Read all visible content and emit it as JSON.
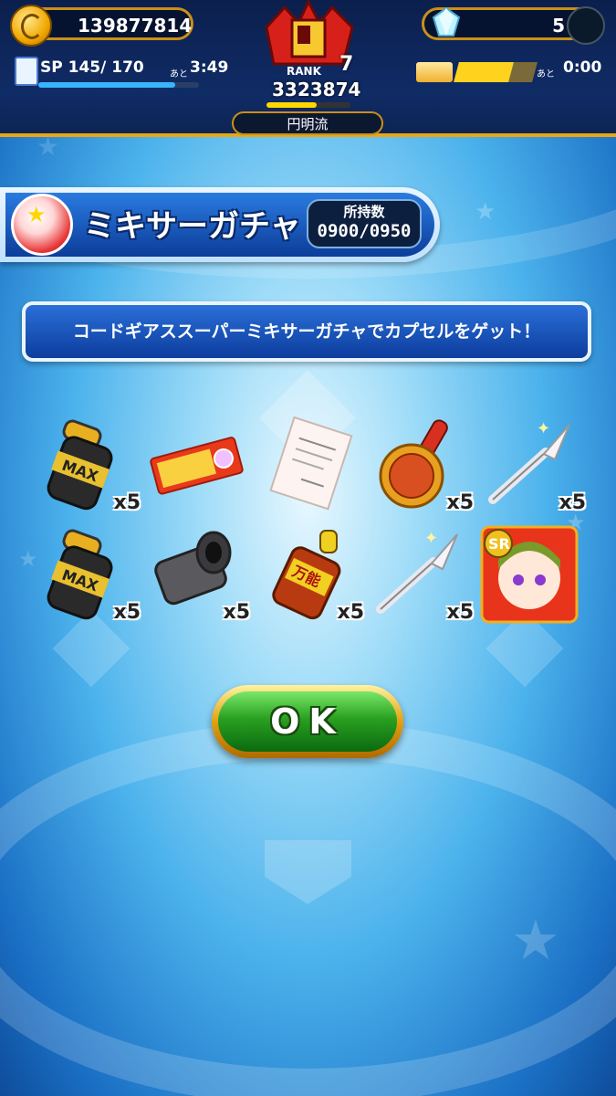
{
  "header": {
    "coins": "139877814",
    "gems": "5",
    "sp_label": "SP",
    "sp_value": "145/ 170",
    "sp_ato": "あと",
    "sp_time": "3:49",
    "sp_fraction": 0.853,
    "rank_label": "RANK",
    "rank_number": "7",
    "score": "3323874",
    "rank_progress": 0.6,
    "guild_name": "円明流",
    "stamina_ato": "あと",
    "stamina_time": "0:00",
    "stamina_segments_filled": 5,
    "stamina_segments_total": 7
  },
  "banner": {
    "title": "ミキサーガチャ",
    "owned_label": "所持数",
    "owned_value": "0900/0950"
  },
  "message": "コードギアススーパーミキサーガチャでカプセルをゲット！",
  "items": [
    {
      "icon": "max-bottle-icon",
      "qty": "x5"
    },
    {
      "icon": "ticket-icon",
      "qty": ""
    },
    {
      "icon": "document-icon",
      "qty": ""
    },
    {
      "icon": "stamp-icon",
      "qty": "x5"
    },
    {
      "icon": "scalpel-icon",
      "qty": "x5"
    },
    {
      "icon": "max-bottle-icon",
      "qty": "x5"
    },
    {
      "icon": "metal-pipe-icon",
      "qty": "x5"
    },
    {
      "icon": "bannou-bottle-icon",
      "qty": "x5"
    },
    {
      "icon": "scalpel-icon",
      "qty": "x5"
    },
    {
      "icon": "sr-character-card-icon",
      "qty": ""
    }
  ],
  "ok_button": "OK",
  "colors": {
    "accent_gold": "#e8a814",
    "button_green": "#2aa020",
    "panel_blue": "#0c3d9a"
  }
}
